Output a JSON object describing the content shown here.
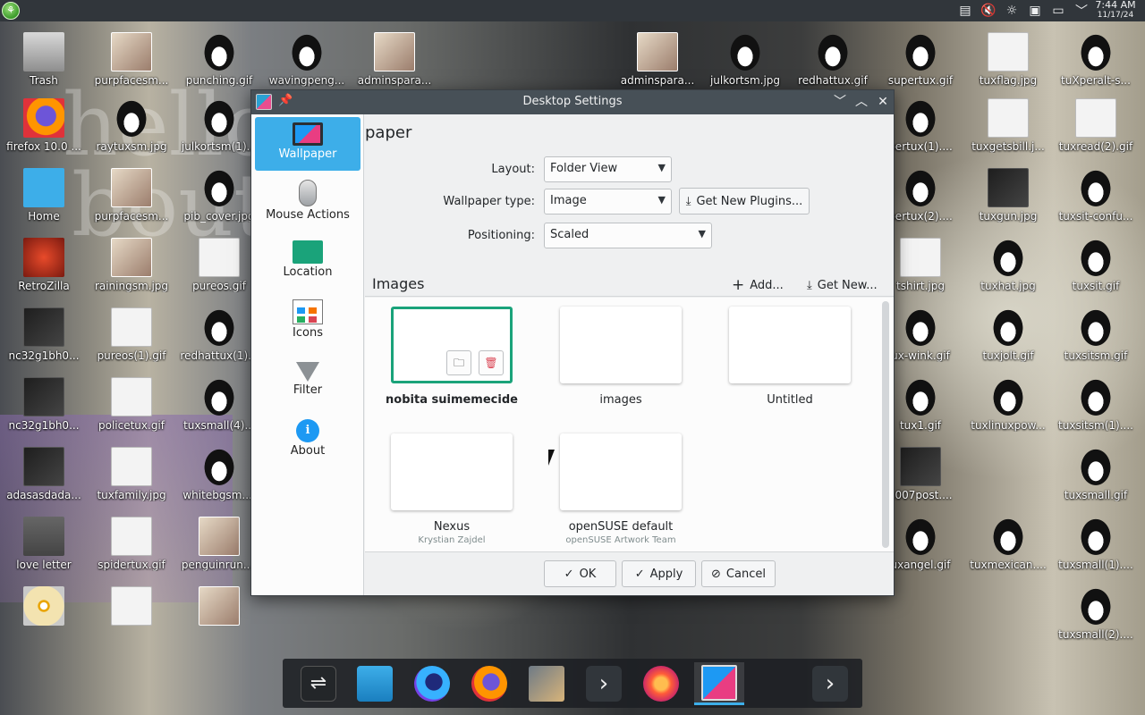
{
  "panel": {
    "start_label": "⚘",
    "time": "7:44 AM",
    "date": "11/17/24"
  },
  "desktop_icons": [
    {
      "label": "Trash",
      "icon": "trash-icon"
    },
    {
      "label": "purpfacesm...",
      "icon": "photo-icon"
    },
    {
      "label": "punching.gif",
      "icon": "tux-icon"
    },
    {
      "label": "wavingpeng...",
      "icon": "tux-icon"
    },
    {
      "label": "adminspara...",
      "icon": "photo-icon"
    },
    {
      "label": "adminspara...",
      "icon": "photo-icon"
    },
    {
      "label": "julkortsm.jpg",
      "icon": "tux-icon"
    },
    {
      "label": "redhattux.gif",
      "icon": "tux-icon"
    },
    {
      "label": "supertux.gif",
      "icon": "tux-icon"
    },
    {
      "label": "tuxflag.jpg",
      "icon": "tux-icon"
    },
    {
      "label": "tuXperalt-s...",
      "icon": "tux-icon"
    },
    {
      "label": "firefox 10.0 ...",
      "icon": "firefox-icon"
    },
    {
      "label": "raytuxsm.jpg",
      "icon": "tux-icon"
    },
    {
      "label": "julkortsm(1)...",
      "icon": "tux-icon"
    },
    {
      "label": "pertux(1)....",
      "icon": "tux-icon"
    },
    {
      "label": "tuxgetsbill.j...",
      "icon": "tux-icon"
    },
    {
      "label": "tuxread(2).gif",
      "icon": "tux-icon"
    },
    {
      "label": "Home",
      "icon": "home-folder-icon"
    },
    {
      "label": "purpfacesm...",
      "icon": "photo-icon"
    },
    {
      "label": "pib_cover.jpg",
      "icon": "tux-icon"
    },
    {
      "label": "pertux(2)....",
      "icon": "tux-icon"
    },
    {
      "label": "tuxgun.jpg",
      "icon": "tux-icon"
    },
    {
      "label": "tuxsit-confu...",
      "icon": "tux-icon"
    },
    {
      "label": "RetroZilla",
      "icon": "retrozilla-icon"
    },
    {
      "label": "rainingsm.jpg",
      "icon": "photo-icon"
    },
    {
      "label": "pureos.gif",
      "icon": "image-icon"
    },
    {
      "label": "tshirt.jpg",
      "icon": "tux-icon"
    },
    {
      "label": "tuxhat.jpg",
      "icon": "tux-icon"
    },
    {
      "label": "tuxsit.gif",
      "icon": "tux-icon"
    },
    {
      "label": "nc32g1bh0...",
      "icon": "dark-image-icon"
    },
    {
      "label": "pureos(1).gif",
      "icon": "image-icon"
    },
    {
      "label": "redhattux(1)...",
      "icon": "tux-icon"
    },
    {
      "label": "ux-wink.gif",
      "icon": "tux-icon"
    },
    {
      "label": "tuxjolt.gif",
      "icon": "tux-icon"
    },
    {
      "label": "tuxsitsm.gif",
      "icon": "tux-icon"
    },
    {
      "label": "nc32g1bh0...",
      "icon": "dark-image-icon"
    },
    {
      "label": "policetux.gif",
      "icon": "tux-icon"
    },
    {
      "label": "tuxsmall(4)...",
      "icon": "tux-icon"
    },
    {
      "label": "tux1.gif",
      "icon": "tux-icon"
    },
    {
      "label": "tuxlinuxpow...",
      "icon": "tux-icon"
    },
    {
      "label": "tuxsitsm(1)....",
      "icon": "tux-icon"
    },
    {
      "label": "adasasdada...",
      "icon": "dark-image-icon"
    },
    {
      "label": "tuxfamily.jpg",
      "icon": "tux-icon"
    },
    {
      "label": "whitebgsm....",
      "icon": "tux-icon"
    },
    {
      "label": "x007post....",
      "icon": "dark-image-icon"
    },
    {
      "label": "tuxsmall.gif",
      "icon": "tux-icon"
    },
    {
      "label": "love letter",
      "icon": "script-file-icon"
    },
    {
      "label": "spidertux.gif",
      "icon": "tux-icon"
    },
    {
      "label": "penguinrun....",
      "icon": "tux-icon"
    },
    {
      "label": "uxangel.gif",
      "icon": "tux-icon"
    },
    {
      "label": "tuxmexican....",
      "icon": "tux-icon"
    },
    {
      "label": "tuxsmall(1)....",
      "icon": "tux-icon"
    },
    {
      "label": "tuxsmall(2)....",
      "icon": "tux-icon"
    }
  ],
  "dialog": {
    "title": "Desktop Settings",
    "heading": "paper",
    "categories": [
      {
        "label": "Wallpaper",
        "icon": "wallpaper-icon"
      },
      {
        "label": "Mouse Actions",
        "icon": "mouse-icon"
      },
      {
        "label": "Location",
        "icon": "folder-icon"
      },
      {
        "label": "Icons",
        "icon": "icons-grid-icon"
      },
      {
        "label": "Filter",
        "icon": "filter-icon"
      },
      {
        "label": "About",
        "icon": "info-icon"
      }
    ],
    "layout_label": "Layout:",
    "layout_value": "Folder View",
    "wallpaper_type_label": "Wallpaper type:",
    "wallpaper_type_value": "Image",
    "get_plugins_label": "Get New Plugins...",
    "positioning_label": "Positioning:",
    "positioning_value": "Scaled",
    "images_heading": "Images",
    "add_label": "Add...",
    "get_new_label": "Get New...",
    "wallpapers": [
      {
        "name": "nobita suimemecide",
        "author": ""
      },
      {
        "name": "images",
        "author": ""
      },
      {
        "name": "Untitled",
        "author": ""
      },
      {
        "name": "Nexus",
        "author": "Krystian Zajdel"
      },
      {
        "name": "openSUSE default",
        "author": "openSUSE Artwork Team"
      }
    ],
    "ok_label": "OK",
    "apply_label": "Apply",
    "cancel_label": "Cancel"
  },
  "dock": {
    "items": [
      {
        "icon": "system-settings-icon"
      },
      {
        "icon": "discover-icon"
      },
      {
        "icon": "firefox-developer-icon"
      },
      {
        "icon": "firefox-icon"
      },
      {
        "icon": "mail-client-icon"
      },
      {
        "icon": "terminal-icon"
      },
      {
        "icon": "firefox-nightly-icon"
      },
      {
        "icon": "desktop-settings-icon"
      },
      {
        "icon": "terminal-icon"
      }
    ]
  },
  "colors": {
    "accent": "#3daee9",
    "selection_border": "#1aa37a",
    "titlebar": "#475057",
    "panel": "#31363b"
  }
}
